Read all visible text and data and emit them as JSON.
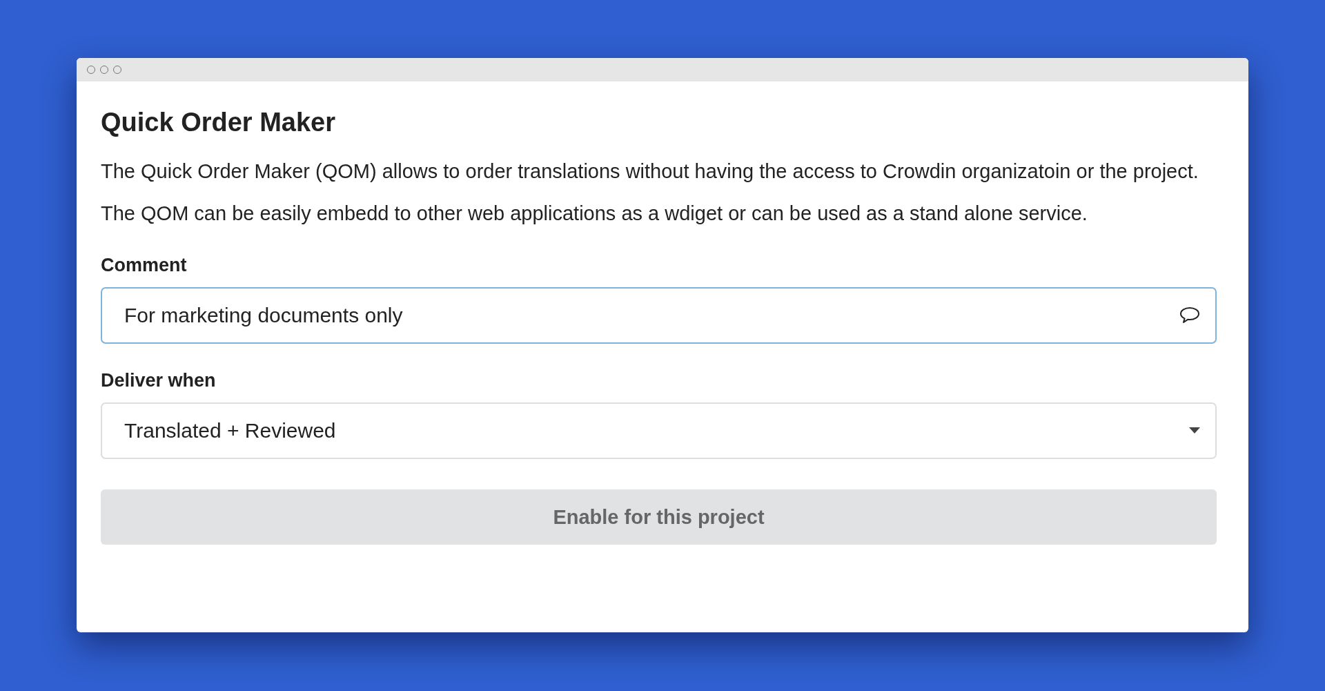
{
  "window": {
    "title": "Quick Order Maker"
  },
  "paragraphs": [
    "The Quick Order Maker (QOM) allows to order translations without having the access to Crowdin organizatoin or the project.",
    "The QOM can be easily embedd to other web applications as a wdiget or can be used as a stand alone service."
  ],
  "comment": {
    "label": "Comment",
    "value": "For marketing documents only",
    "focused": true
  },
  "deliver": {
    "label": "Deliver when",
    "value": "Translated + Reviewed"
  },
  "button": {
    "label": "Enable for this project",
    "disabled": true
  }
}
